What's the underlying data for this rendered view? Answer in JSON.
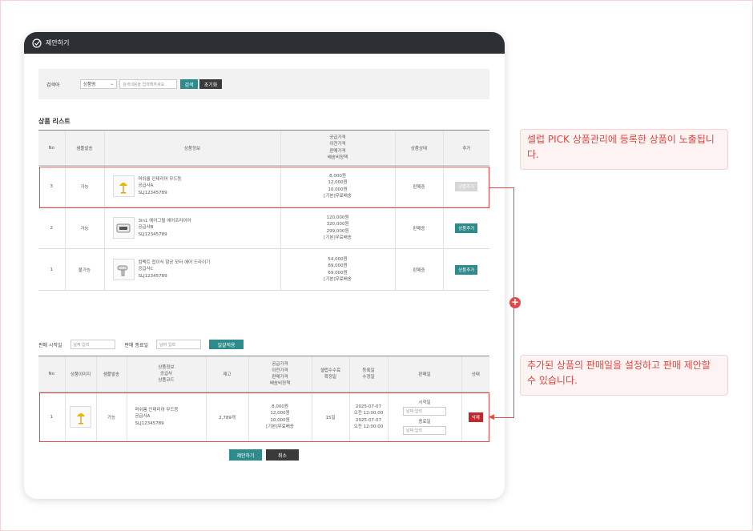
{
  "window": {
    "title": "제안하기"
  },
  "search": {
    "label": "검색어",
    "select_value": "상품명",
    "placeholder": "검색내용을 입력해주세요.",
    "search_btn": "검색",
    "reset_btn": "초기화"
  },
  "list": {
    "title": "상품 리스트",
    "headers": {
      "no": "No",
      "sample": "샘플발송",
      "info": "상품정보",
      "price": [
        "공급가격",
        "이전가격",
        "판매가격",
        "배송비정책"
      ],
      "status": "상품상태",
      "add": "추가"
    },
    "rows": [
      {
        "no": "3",
        "sample": "가능",
        "name": "머쉬룸 인테리어 무드등",
        "supplier": "공급사A",
        "code": "SLJ12345789",
        "prices": [
          "8,000원",
          "12,000원",
          "10,000원",
          "[기본]무료배송"
        ],
        "status": "판매중",
        "add": "상품추가"
      },
      {
        "no": "2",
        "sample": "가능",
        "name": "3in1 에어그릴 에어프라이어",
        "supplier": "공급사B",
        "code": "SLJ12345789",
        "prices": [
          "120,000원",
          "320,000원",
          "299,000원",
          "[기본]무료배송"
        ],
        "status": "판매중",
        "add": "상품추가"
      },
      {
        "no": "1",
        "sample": "불가능",
        "name": "컴팩트 접이식 항공 모터 에어 드라이기",
        "supplier": "공급사C",
        "code": "SLJ12345789",
        "prices": [
          "54,000원",
          "89,000원",
          "69,000원",
          "[기본]무료배송"
        ],
        "status": "판매중",
        "add": "상품추가"
      }
    ]
  },
  "dates": {
    "start_label": "판매 시작일",
    "end_label": "판매 종료일",
    "placeholder": "날짜 입력",
    "apply_btn": "일괄적용"
  },
  "selected": {
    "headers": {
      "no": "No",
      "image": "상품이미지",
      "sample": "샘플발송",
      "info": [
        "상품정보",
        "공급사",
        "상품코드"
      ],
      "stock": "재고",
      "price": [
        "공급가격",
        "이전가격",
        "판매가격",
        "배송비정책"
      ],
      "fee": [
        "셀럽수수료",
        "확정일"
      ],
      "reg": [
        "등록일",
        "수정일"
      ],
      "period": "판매일",
      "state": "상태"
    },
    "row": {
      "no": "1",
      "sample": "가능",
      "name": "머쉬룸 인테리어 무드등",
      "supplier": "공급사A",
      "code": "SLJ12345789",
      "stock": "2,789개",
      "prices": [
        "8,000원",
        "12,000원",
        "10,000원",
        "[기본]무료배송"
      ],
      "fee": "15일",
      "reg": [
        "2025-07-07",
        "오전 12:00:00",
        "2025-07-07",
        "오전 12:00:00"
      ],
      "start_label": "시작일",
      "end_label": "종료일",
      "date_placeholder": "날짜 입력",
      "state_btn": "삭제"
    }
  },
  "actions": {
    "propose": "제안하기",
    "cancel": "취소"
  },
  "notes": {
    "top": "셀럽 PICK 상품관리에 등록한 상품이 노출됩니다.",
    "bottom": "추가된 상품의 판매일을 설정하고 판매 제안할 수 있습니다."
  },
  "colors": {
    "accent": "#2e8b8b",
    "highlight": "#e24a4a",
    "titlebar": "#2c2f33"
  }
}
